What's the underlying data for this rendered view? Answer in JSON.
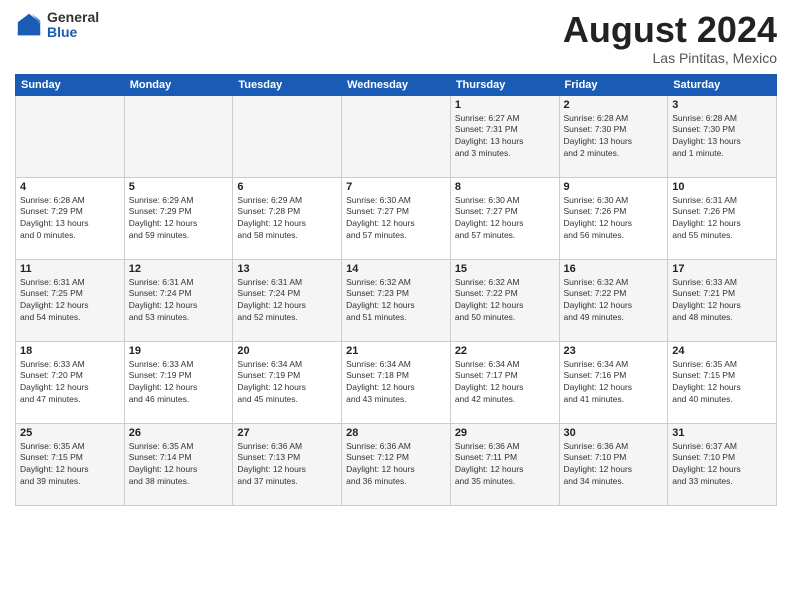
{
  "header": {
    "logo_general": "General",
    "logo_blue": "Blue",
    "month_title": "August 2024",
    "location": "Las Pintitas, Mexico"
  },
  "days_of_week": [
    "Sunday",
    "Monday",
    "Tuesday",
    "Wednesday",
    "Thursday",
    "Friday",
    "Saturday"
  ],
  "weeks": [
    {
      "days": [
        {
          "num": "",
          "info": ""
        },
        {
          "num": "",
          "info": ""
        },
        {
          "num": "",
          "info": ""
        },
        {
          "num": "",
          "info": ""
        },
        {
          "num": "1",
          "info": "Sunrise: 6:27 AM\nSunset: 7:31 PM\nDaylight: 13 hours\nand 3 minutes."
        },
        {
          "num": "2",
          "info": "Sunrise: 6:28 AM\nSunset: 7:30 PM\nDaylight: 13 hours\nand 2 minutes."
        },
        {
          "num": "3",
          "info": "Sunrise: 6:28 AM\nSunset: 7:30 PM\nDaylight: 13 hours\nand 1 minute."
        }
      ]
    },
    {
      "days": [
        {
          "num": "4",
          "info": "Sunrise: 6:28 AM\nSunset: 7:29 PM\nDaylight: 13 hours\nand 0 minutes."
        },
        {
          "num": "5",
          "info": "Sunrise: 6:29 AM\nSunset: 7:29 PM\nDaylight: 12 hours\nand 59 minutes."
        },
        {
          "num": "6",
          "info": "Sunrise: 6:29 AM\nSunset: 7:28 PM\nDaylight: 12 hours\nand 58 minutes."
        },
        {
          "num": "7",
          "info": "Sunrise: 6:30 AM\nSunset: 7:27 PM\nDaylight: 12 hours\nand 57 minutes."
        },
        {
          "num": "8",
          "info": "Sunrise: 6:30 AM\nSunset: 7:27 PM\nDaylight: 12 hours\nand 57 minutes."
        },
        {
          "num": "9",
          "info": "Sunrise: 6:30 AM\nSunset: 7:26 PM\nDaylight: 12 hours\nand 56 minutes."
        },
        {
          "num": "10",
          "info": "Sunrise: 6:31 AM\nSunset: 7:26 PM\nDaylight: 12 hours\nand 55 minutes."
        }
      ]
    },
    {
      "days": [
        {
          "num": "11",
          "info": "Sunrise: 6:31 AM\nSunset: 7:25 PM\nDaylight: 12 hours\nand 54 minutes."
        },
        {
          "num": "12",
          "info": "Sunrise: 6:31 AM\nSunset: 7:24 PM\nDaylight: 12 hours\nand 53 minutes."
        },
        {
          "num": "13",
          "info": "Sunrise: 6:31 AM\nSunset: 7:24 PM\nDaylight: 12 hours\nand 52 minutes."
        },
        {
          "num": "14",
          "info": "Sunrise: 6:32 AM\nSunset: 7:23 PM\nDaylight: 12 hours\nand 51 minutes."
        },
        {
          "num": "15",
          "info": "Sunrise: 6:32 AM\nSunset: 7:22 PM\nDaylight: 12 hours\nand 50 minutes."
        },
        {
          "num": "16",
          "info": "Sunrise: 6:32 AM\nSunset: 7:22 PM\nDaylight: 12 hours\nand 49 minutes."
        },
        {
          "num": "17",
          "info": "Sunrise: 6:33 AM\nSunset: 7:21 PM\nDaylight: 12 hours\nand 48 minutes."
        }
      ]
    },
    {
      "days": [
        {
          "num": "18",
          "info": "Sunrise: 6:33 AM\nSunset: 7:20 PM\nDaylight: 12 hours\nand 47 minutes."
        },
        {
          "num": "19",
          "info": "Sunrise: 6:33 AM\nSunset: 7:19 PM\nDaylight: 12 hours\nand 46 minutes."
        },
        {
          "num": "20",
          "info": "Sunrise: 6:34 AM\nSunset: 7:19 PM\nDaylight: 12 hours\nand 45 minutes."
        },
        {
          "num": "21",
          "info": "Sunrise: 6:34 AM\nSunset: 7:18 PM\nDaylight: 12 hours\nand 43 minutes."
        },
        {
          "num": "22",
          "info": "Sunrise: 6:34 AM\nSunset: 7:17 PM\nDaylight: 12 hours\nand 42 minutes."
        },
        {
          "num": "23",
          "info": "Sunrise: 6:34 AM\nSunset: 7:16 PM\nDaylight: 12 hours\nand 41 minutes."
        },
        {
          "num": "24",
          "info": "Sunrise: 6:35 AM\nSunset: 7:15 PM\nDaylight: 12 hours\nand 40 minutes."
        }
      ]
    },
    {
      "days": [
        {
          "num": "25",
          "info": "Sunrise: 6:35 AM\nSunset: 7:15 PM\nDaylight: 12 hours\nand 39 minutes."
        },
        {
          "num": "26",
          "info": "Sunrise: 6:35 AM\nSunset: 7:14 PM\nDaylight: 12 hours\nand 38 minutes."
        },
        {
          "num": "27",
          "info": "Sunrise: 6:36 AM\nSunset: 7:13 PM\nDaylight: 12 hours\nand 37 minutes."
        },
        {
          "num": "28",
          "info": "Sunrise: 6:36 AM\nSunset: 7:12 PM\nDaylight: 12 hours\nand 36 minutes."
        },
        {
          "num": "29",
          "info": "Sunrise: 6:36 AM\nSunset: 7:11 PM\nDaylight: 12 hours\nand 35 minutes."
        },
        {
          "num": "30",
          "info": "Sunrise: 6:36 AM\nSunset: 7:10 PM\nDaylight: 12 hours\nand 34 minutes."
        },
        {
          "num": "31",
          "info": "Sunrise: 6:37 AM\nSunset: 7:10 PM\nDaylight: 12 hours\nand 33 minutes."
        }
      ]
    }
  ]
}
